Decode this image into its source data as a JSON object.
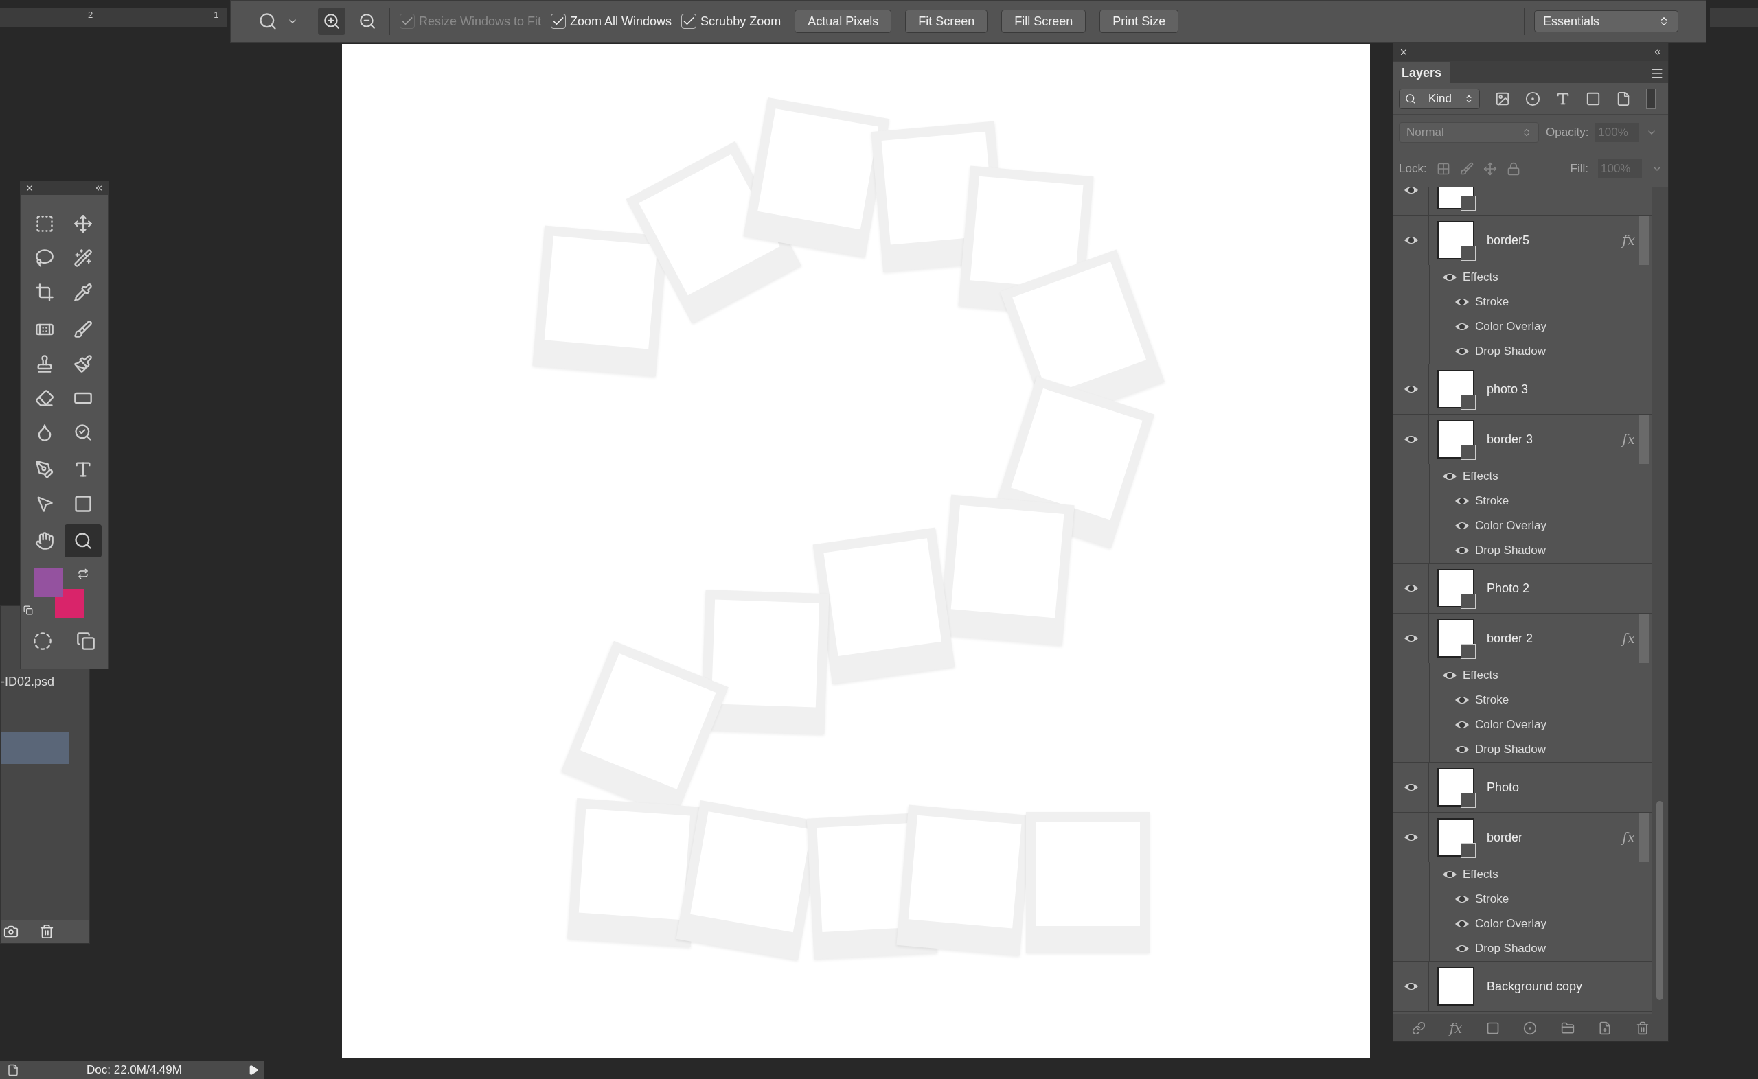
{
  "title_rulers": {
    "labels": [
      "2",
      "1"
    ]
  },
  "options_bar": {
    "checkboxes": [
      {
        "label": "Resize Windows to Fit",
        "checked": true,
        "disabled": true
      },
      {
        "label": "Zoom All Windows",
        "checked": true,
        "disabled": false
      },
      {
        "label": "Scrubby Zoom",
        "checked": true,
        "disabled": false
      }
    ],
    "buttons": [
      "Actual Pixels",
      "Fit Screen",
      "Fill Screen",
      "Print Size"
    ],
    "workspace": "Essentials"
  },
  "tools": [
    {
      "selected": false
    },
    {
      "selected": false
    },
    {
      "selected": false
    },
    {
      "selected": false
    },
    {
      "selected": false
    },
    {
      "selected": false
    },
    {
      "selected": false
    },
    {
      "selected": false
    },
    {
      "selected": false
    },
    {
      "selected": false
    },
    {
      "selected": false
    },
    {
      "selected": false
    },
    {
      "selected": false
    },
    {
      "selected": false
    },
    {
      "selected": false
    },
    {
      "selected": false
    },
    {
      "selected": false
    },
    {
      "selected": false
    },
    {
      "selected": false
    },
    {
      "selected": true
    }
  ],
  "color_swatches": [
    {
      "color": "#94529f"
    },
    {
      "color": "#d9246a"
    }
  ],
  "document_panel": {
    "filename": "-ID02.psd"
  },
  "layers_panel": {
    "tab": "Layers",
    "filter": "Kind",
    "blend_mode": "Normal",
    "opacity_label": "Opacity:",
    "opacity": "100%",
    "lock_label": "Lock:",
    "fill_label": "Fill:",
    "fill": "100%",
    "footer_fx": "fx",
    "layers": [
      {
        "visible": true
      },
      {
        "name": "border5",
        "visible": true,
        "fx": "fx",
        "effects_label": "Effects",
        "effects": [
          {
            "name": "Stroke",
            "visible": true
          },
          {
            "name": "Color Overlay",
            "visible": true
          },
          {
            "name": "Drop Shadow",
            "visible": true
          }
        ]
      },
      {
        "name": "photo 3",
        "visible": true
      },
      {
        "name": "border 3",
        "visible": true,
        "fx": "fx",
        "effects_label": "Effects",
        "effects": [
          {
            "name": "Stroke",
            "visible": true
          },
          {
            "name": "Color Overlay",
            "visible": true
          },
          {
            "name": "Drop Shadow",
            "visible": true
          }
        ]
      },
      {
        "name": "Photo 2",
        "visible": true
      },
      {
        "name": "border 2",
        "visible": true,
        "fx": "fx",
        "effects_label": "Effects",
        "effects": [
          {
            "name": "Stroke",
            "visible": true
          },
          {
            "name": "Color Overlay",
            "visible": true
          },
          {
            "name": "Drop Shadow",
            "visible": true
          }
        ]
      },
      {
        "name": "Photo",
        "visible": true
      },
      {
        "name": "border",
        "visible": true,
        "fx": "fx",
        "effects_label": "Effects",
        "effects": [
          {
            "name": "Stroke",
            "visible": true
          },
          {
            "name": "Color Overlay",
            "visible": true
          },
          {
            "name": "Drop Shadow",
            "visible": true
          }
        ]
      },
      {
        "name": "Background copy",
        "visible": true
      }
    ]
  },
  "status_bar": {
    "doc": "Doc: 22.0M/4.49M"
  }
}
